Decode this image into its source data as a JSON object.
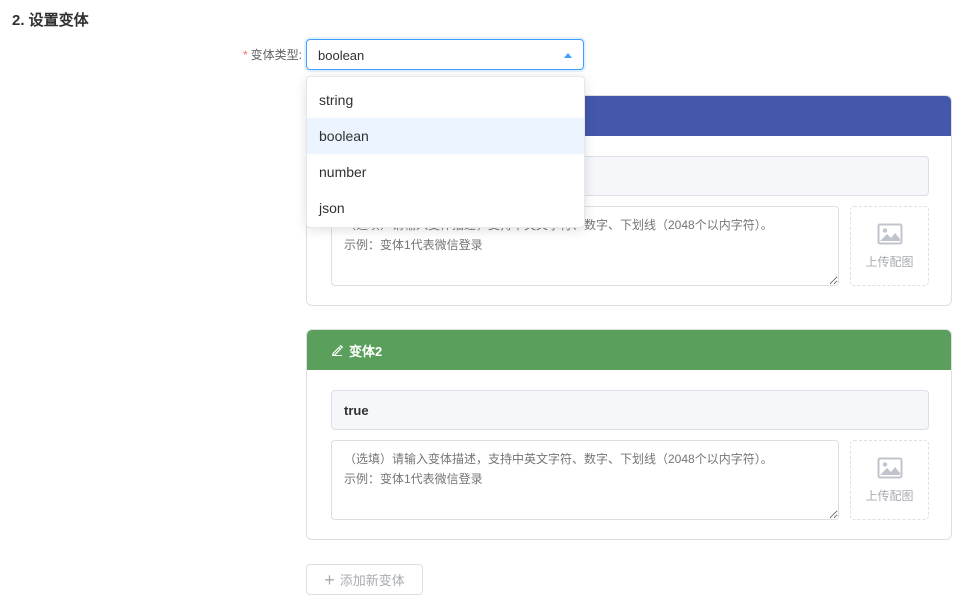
{
  "section": {
    "title": "2. 设置变体"
  },
  "form": {
    "required_mark": "*",
    "type_label": "变体类型:",
    "selected_type": "boolean"
  },
  "dropdown": {
    "options": [
      "string",
      "boolean",
      "number",
      "json"
    ],
    "highlighted": "boolean"
  },
  "variants": [
    {
      "title": "",
      "value": "",
      "description_placeholder": "（选填）请输入变体描述，支持中英文字符、数字、下划线（2048个以内字符）。\n示例：变体1代表微信登录",
      "upload_label": "上传配图",
      "header_color": "#4358ab"
    },
    {
      "title": "变体2",
      "value": "true",
      "description_placeholder": "（选填）请输入变体描述，支持中英文字符、数字、下划线（2048个以内字符）。\n示例：变体1代表微信登录",
      "upload_label": "上传配图",
      "header_color": "#5aa05c"
    }
  ],
  "add_button": {
    "label": "添加新变体"
  },
  "colors": {
    "primary": "#409eff",
    "required": "#f56c6c"
  }
}
